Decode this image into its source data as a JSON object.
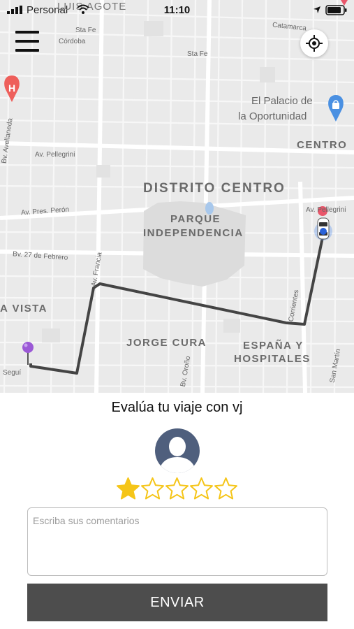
{
  "status_bar": {
    "carrier": "Personal",
    "time": "11:10"
  },
  "map": {
    "streets": {
      "luis_agote": "LUIS AGOTE",
      "sta_fe_1": "Sta Fe",
      "cordoba": "Córdoba",
      "sta_fe_2": "Sta Fe",
      "catamarca": "Catamarca",
      "av_pellegrini_1": "Av. Pellegrini",
      "av_pellegrini_2": "Av. Pellegrini",
      "av_pres_peron": "Av. Pres. Perón",
      "bv_27_febrero": "Bv. 27 de Febrero",
      "av_francia": "Av. Francia",
      "corrientes": "Corrientes",
      "bv_avellaneda": "Bv. Avellaneda",
      "bv_orono": "Bv. Oroño",
      "san_martin": "San Martín",
      "segui": "Seguí"
    },
    "districts": {
      "distrito_centro": "DISTRITO CENTRO",
      "parque": "PARQUE",
      "independencia": "INDEPENDENCIA",
      "centro": "CENTRO",
      "vista": "A VISTA",
      "jorge_cura": "JORGE CURA",
      "espana": "ESPAÑA Y",
      "hospitales": "HOSPITALES"
    },
    "poi": {
      "palacio_line1": "El Palacio de",
      "palacio_line2": "la Oportunidad"
    },
    "icons": {
      "menu": "menu-icon",
      "locate": "crosshair-icon",
      "hospital": "hospital-marker-icon",
      "shopping": "shopping-marker-icon",
      "origin": "origin-pin-icon",
      "car": "car-icon"
    },
    "colors": {
      "route": "#444444",
      "origin_pin": "#9b59d6",
      "hospital_pin": "#ee5f5b",
      "shopping_pin": "#4a90e2",
      "car_halo": "#7aa7ee"
    }
  },
  "rating": {
    "title": "Evalúa tu viaje con vj",
    "avatar_icon": "user-avatar-icon",
    "stars_total": 5,
    "stars_selected": 1,
    "star_color": "#f5c518",
    "comments_placeholder": "Escriba sus comentarios",
    "comments_value": "",
    "send_label": "ENVIAR",
    "send_color": "#4d4d4d"
  }
}
